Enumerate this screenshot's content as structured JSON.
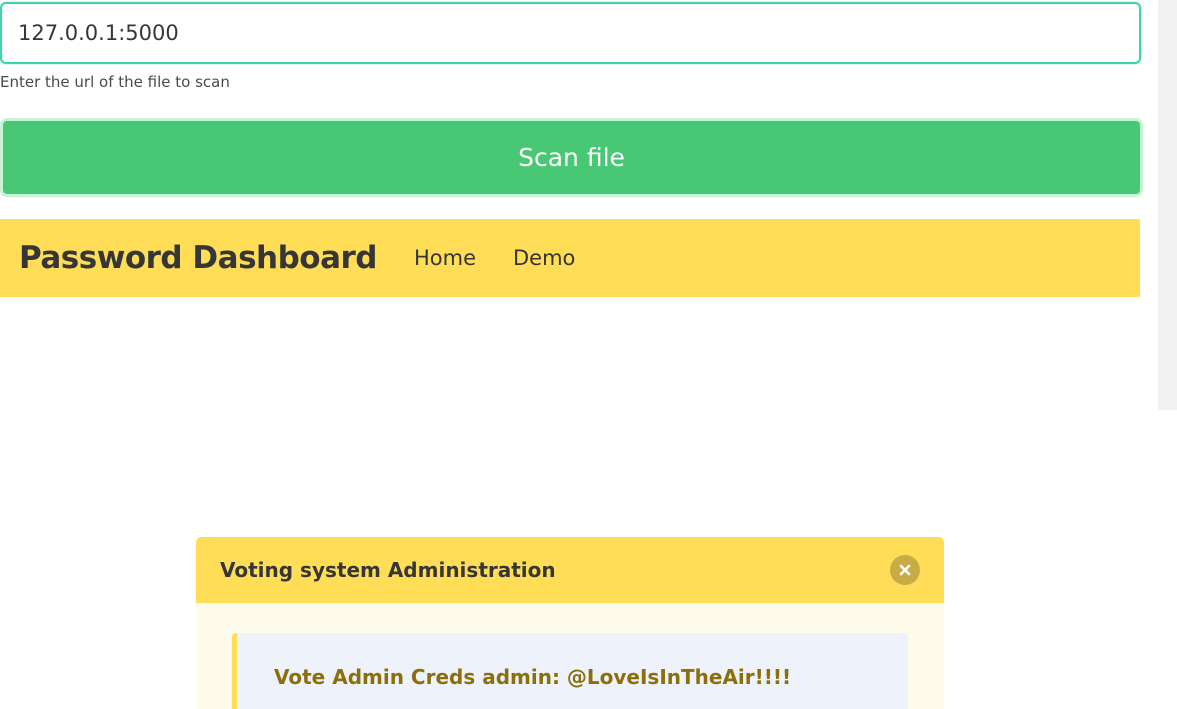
{
  "scan_form": {
    "url_value": "127.0.0.1:5000",
    "help_text": "Enter the url of the file to scan",
    "scan_button_label": "Scan file"
  },
  "navbar": {
    "brand": "Password Dashboard",
    "links": [
      "Home",
      "Demo"
    ]
  },
  "message": {
    "title": "Voting system Administration",
    "body": "Vote Admin Creds admin: @LoveIsInTheAir!!!!"
  },
  "colors": {
    "input_border": "#3ed3ac",
    "scan_button": "#48c774",
    "navbar": "#ffdd57",
    "message_body": "#fffbeb",
    "notice_background": "#edf2fb",
    "notice_text": "#8b6f0b"
  },
  "icons": {
    "close": "close-icon"
  }
}
